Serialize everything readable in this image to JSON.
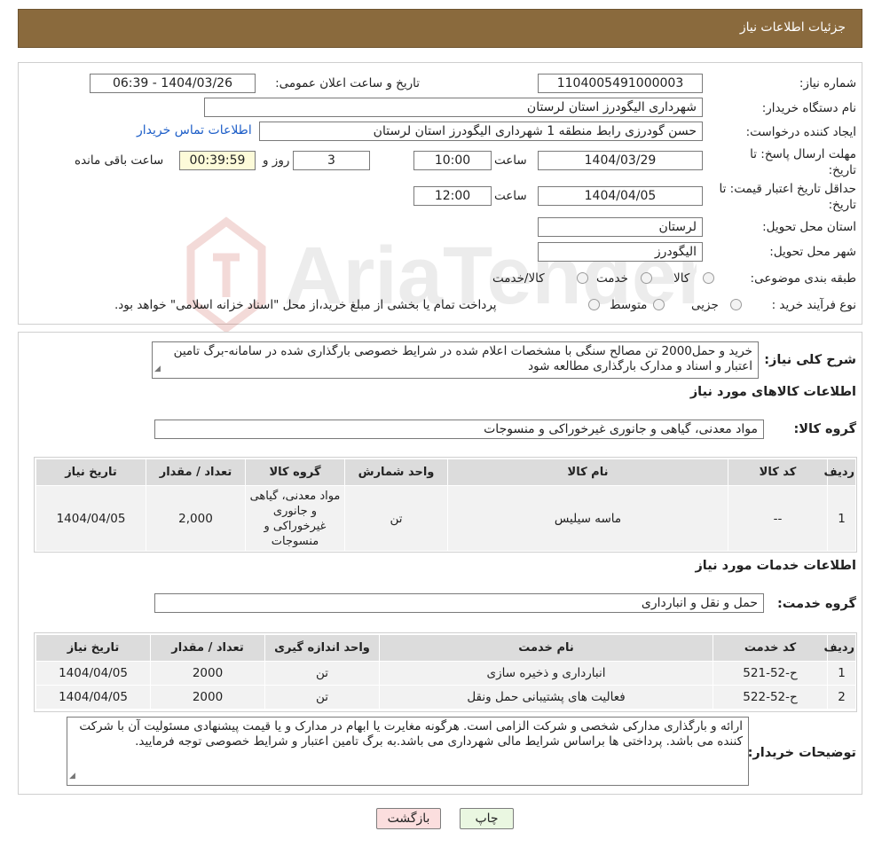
{
  "header": {
    "title": "جزئیات اطلاعات نیاز"
  },
  "form": {
    "need_number_label": "شماره نیاز:",
    "need_number": "1104005491000003",
    "announce_label": "تاریخ و ساعت اعلان عمومی:",
    "announce_value": "1404/03/26 - 06:39",
    "buyer_org_label": "نام دستگاه خریدار:",
    "buyer_org": "شهرداری الیگودرز استان لرستان",
    "creator_label": "ایجاد کننده درخواست:",
    "creator": "حسن گودرزی رابط منطقه 1 شهرداری الیگودرز استان لرستان",
    "contact_link": "اطلاعات تماس خریدار",
    "deadline_label_1": "مهلت ارسال پاسخ: تا",
    "deadline_label_2": "تاریخ:",
    "deadline_date": "1404/03/29",
    "time_label": "ساعت",
    "deadline_time": "10:00",
    "days_value": "3",
    "days_label": "روز و",
    "remaining_time": "00:39:59",
    "remaining_label": "ساعت باقی مانده",
    "validity_label_1": "حداقل تاریخ اعتبار قیمت: تا",
    "validity_label_2": "تاریخ:",
    "validity_date": "1404/04/05",
    "validity_time": "12:00",
    "province_label": "استان محل تحویل:",
    "province": "لرستان",
    "city_label": "شهر محل تحویل:",
    "city": "الیگودرز",
    "category_label": "طبقه بندی موضوعی:",
    "category_options": [
      "کالا",
      "خدمت",
      "کالا/خدمت"
    ],
    "process_label": "نوع فرآیند خرید :",
    "process_options": [
      "جزیی",
      "متوسط"
    ],
    "process_note": "پرداخت تمام یا بخشی از مبلغ خرید،از محل \"اسناد خزانه اسلامی\" خواهد بود."
  },
  "summary": {
    "label": "شرح کلی نیاز:",
    "text": "خرید و حمل2000 تن مصالح سنگی با مشخصات اعلام شده در شرایط خصوصی بارگذاری شده در سامانه-برگ تامین اعتبار و اسناد و مدارک بارگذاری مطالعه شود"
  },
  "goods": {
    "section_title": "اطلاعات کالاهای مورد نیاز",
    "group_label": "گروه کالا:",
    "group_value": "مواد معدنی، گیاهی و جانوری غیرخوراکی و منسوجات",
    "columns": [
      "ردیف",
      "کد کالا",
      "نام کالا",
      "واحد شمارش",
      "گروه کالا",
      "تعداد / مقدار",
      "تاریخ نیاز"
    ],
    "rows": [
      [
        "1",
        "--",
        "ماسه سیلیس",
        "تن",
        "مواد معدنی، گیاهی و جانوری غیرخوراکی و منسوجات",
        "2,000",
        "1404/04/05"
      ]
    ]
  },
  "services": {
    "section_title": "اطلاعات خدمات مورد نیاز",
    "group_label": "گروه خدمت:",
    "group_value": "حمل و نقل و انبارداری",
    "columns": [
      "ردیف",
      "کد خدمت",
      "نام خدمت",
      "واحد اندازه گیری",
      "تعداد / مقدار",
      "تاریخ نیاز"
    ],
    "rows": [
      [
        "1",
        "ح-52-521",
        "انبارداری و ذخیره سازی",
        "تن",
        "2000",
        "1404/04/05"
      ],
      [
        "2",
        "ح-52-522",
        "فعالیت های پشتیبانی حمل ونقل",
        "تن",
        "2000",
        "1404/04/05"
      ]
    ]
  },
  "notes": {
    "label": "توضیحات خریدار:",
    "text": "ارائه و بارگذاری مدارکی شخصی و شرکت الزامی است. هرگونه مغایرت یا ابهام در مدارک و یا قیمت پیشنهادی مسئولیت آن با شرکت کننده می باشد. پرداختی ها براساس شرایط مالی شهرداری می باشد.به برگ تامین اعتبار و شرایط خصوصی توجه فرمایید."
  },
  "buttons": {
    "print": "چاپ",
    "back": "بازگشت"
  },
  "watermark": {
    "text": "AriaTender.neT"
  },
  "colors": {
    "header": "#8a6a3d",
    "link": "#1d5ec8",
    "back_button": "#fbdede",
    "print_button": "#eaf7e1"
  }
}
